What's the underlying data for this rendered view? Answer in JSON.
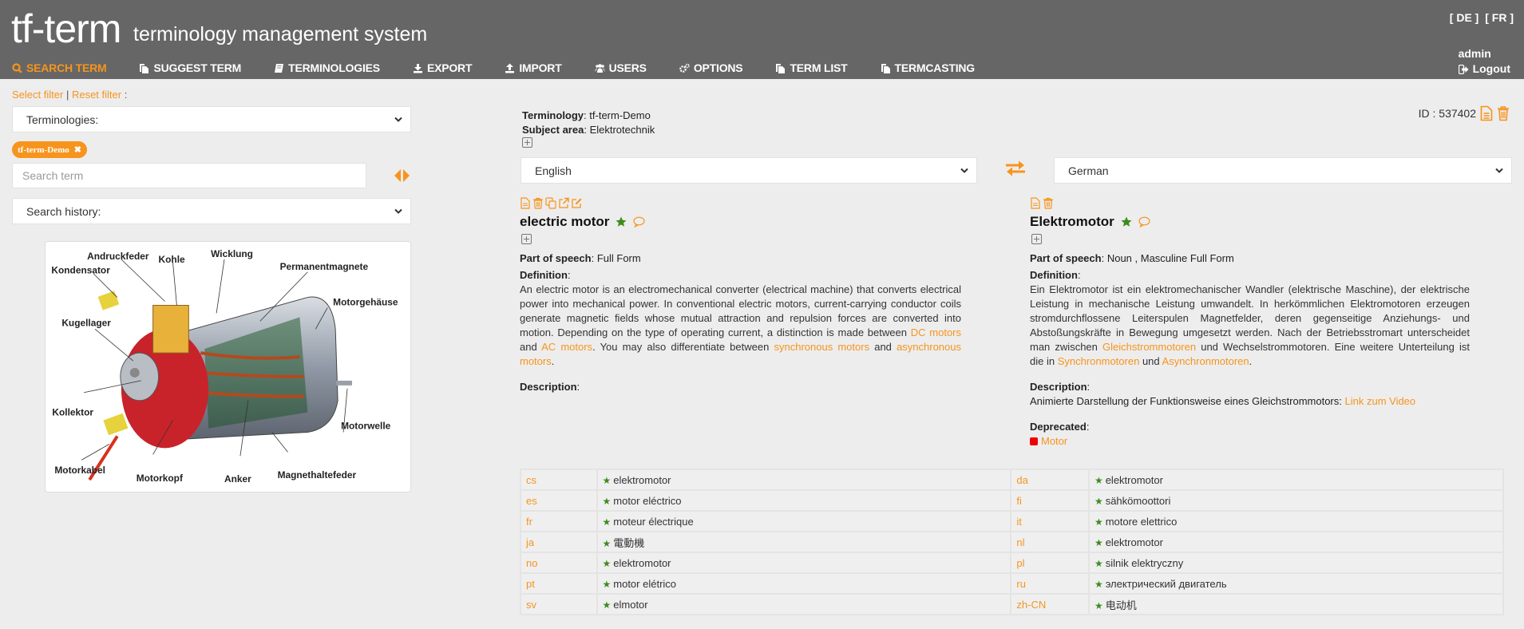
{
  "header": {
    "logo": "tf-term",
    "subtitle": "terminology management system",
    "languages": [
      "[ DE ]",
      "[ FR ]"
    ],
    "username": "admin",
    "logout_label": "Logout"
  },
  "nav": {
    "items": [
      {
        "label": "Search term",
        "icon": "search-icon",
        "active": true
      },
      {
        "label": "Suggest term",
        "icon": "copy-document-icon",
        "active": false
      },
      {
        "label": "Terminologies",
        "icon": "book-icon",
        "active": false
      },
      {
        "label": "Export",
        "icon": "download-icon",
        "active": false
      },
      {
        "label": "Import",
        "icon": "upload-icon",
        "active": false
      },
      {
        "label": "Users",
        "icon": "users-icon",
        "active": false
      },
      {
        "label": "Options",
        "icon": "gears-icon",
        "active": false
      },
      {
        "label": "Term list",
        "icon": "copy-document-icon",
        "active": false
      },
      {
        "label": "Termcasting",
        "icon": "copy-document-icon",
        "active": false
      }
    ]
  },
  "sidebar": {
    "select_filter": "Select filter",
    "separator": "|",
    "reset_filter": "Reset filter",
    "colon": ":",
    "terminologies_select": "Terminologies:",
    "active_tag": "tf-term-Demo",
    "search_placeholder": "Search term",
    "search_value": "",
    "history_select": "Search history:",
    "diagram_labels": {
      "andruckfeder": "Andruckfeder",
      "kohle": "Kohle",
      "wicklung": "Wicklung",
      "permanentmagnete": "Permanentmagnete",
      "kondensator": "Kondensator",
      "motorgehaeuse": "Motorgehäuse",
      "kugellager": "Kugellager",
      "kollektor": "Kollektor",
      "motorwelle": "Motorwelle",
      "motorkabel": "Motorkabel",
      "motorkopf": "Motorkopf",
      "anker": "Anker",
      "magnethaltefeder": "Magnethaltefeder"
    }
  },
  "entry": {
    "terminology_label": "Terminology",
    "terminology_value": "tf-term-Demo",
    "subject_label": "Subject area",
    "subject_value": "Elektrotechnik",
    "id_label": "ID : 537402",
    "source_language": "English",
    "target_language": "German",
    "accent_color": "#f7941d",
    "preferred_color": "#3c8c1c",
    "deprecated_color": "#ee0000"
  },
  "source_term": {
    "term": "electric motor",
    "pos_label": "Part of speech",
    "pos_value": "Full Form",
    "definition_label": "Definition",
    "definition_parts": {
      "p1": "An electric motor is an electromechanical converter (electrical machine) that converts electrical power into mechanical power. In conventional electric motors, current-carrying conductor coils generate magnetic fields whose mutual attraction and repulsion forces are converted into motion. Depending on the type of operating current, a distinction is made between ",
      "l1": "DC motors",
      "p2": " and ",
      "l2": "AC motors",
      "p3": ". You may also differentiate between ",
      "l3": "synchronous motors",
      "p4": " and ",
      "l4": "asynchronous motors",
      "p5": "."
    },
    "description_label": "Description"
  },
  "target_term": {
    "term": "Elektromotor",
    "pos_label": "Part of speech",
    "pos_value": "Noun , Masculine Full Form",
    "definition_label": "Definition",
    "definition_parts": {
      "p1": "Ein Elektromotor ist ein elektromechanischer Wandler (elektrische Maschine), der elektrische Leistung in mechanische Leistung umwandelt. In herkömmlichen Elektromotoren erzeugen stromdurchflossene Leiterspulen Magnetfelder, deren gegenseitige Anziehungs- und Abstoßungskräfte in Bewegung umgesetzt werden. Nach der Betriebsstromart unterscheidet man zwischen ",
      "l1": "Gleichstrommotoren",
      "p2": " und Wechselstrommotoren. Eine weitere Unterteilung ist die in ",
      "l2": "Synchronmotoren",
      "p3": " und ",
      "l3": "Asynchronmotoren",
      "p4": "."
    },
    "description_label": "Description",
    "description_text": "Animierte Darstellung der Funktionsweise eines Gleichstrommotors: ",
    "description_link": "Link zum Video",
    "deprecated_label": "Deprecated",
    "deprecated_term": "Motor"
  },
  "translations": [
    {
      "left_code": "cs",
      "left_term": "elektromotor",
      "right_code": "da",
      "right_term": "elektromotor"
    },
    {
      "left_code": "es",
      "left_term": "motor eléctrico",
      "right_code": "fi",
      "right_term": "sähkömoottori"
    },
    {
      "left_code": "fr",
      "left_term": "moteur électrique",
      "right_code": "it",
      "right_term": "motore elettrico"
    },
    {
      "left_code": "ja",
      "left_term": "電動機",
      "right_code": "nl",
      "right_term": "elektromotor"
    },
    {
      "left_code": "no",
      "left_term": "elektromotor",
      "right_code": "pl",
      "right_term": "silnik elektryczny"
    },
    {
      "left_code": "pt",
      "left_term": "motor elétrico",
      "right_code": "ru",
      "right_term": "электрический двигатель"
    },
    {
      "left_code": "sv",
      "left_term": "elmotor",
      "right_code": "zh-CN",
      "right_term": "电动机"
    }
  ]
}
